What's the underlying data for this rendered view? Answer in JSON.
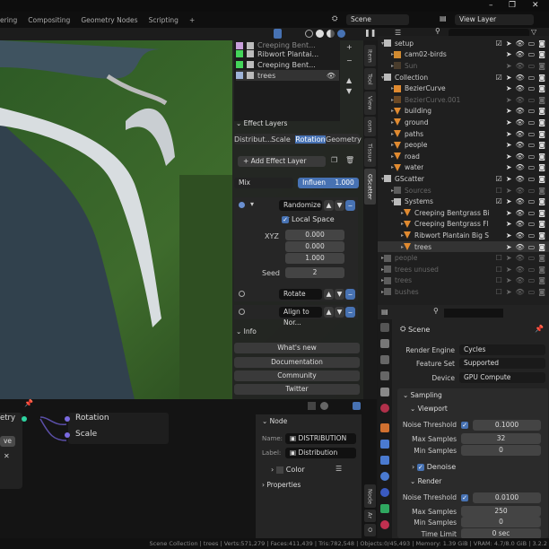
{
  "window": {
    "minimize": "–",
    "maximize": "❐",
    "close": "✕"
  },
  "workspace_tabs": [
    "ering",
    "Compositing",
    "Geometry Nodes",
    "Scripting",
    "+"
  ],
  "scene_field": "Scene",
  "view_layer_field": "View Layer",
  "npanel": {
    "layers": [
      {
        "name": "Creeping Bent...",
        "color": "#c9a0dc"
      },
      {
        "name": "Ribwort Plantai...",
        "color": "#44d45a"
      },
      {
        "name": "Creeping Bent...",
        "color": "#44d45a"
      },
      {
        "name": "trees",
        "color": "#9fb4d8"
      }
    ],
    "effect_layers_title": "Effect Layers",
    "effect_tabs": [
      "Distribut...",
      "Scale",
      "Rotation",
      "Geometry"
    ],
    "active_effect_tab": "Rotation",
    "add_effect_layer": "Add Effect Layer",
    "blend_mode": "Mix",
    "influence_label": "Influen",
    "influence_value": "1.000",
    "effects": [
      {
        "name": "Randomize ...",
        "expanded": true
      },
      {
        "name": "Rotate",
        "expanded": false
      },
      {
        "name": "Align to Nor...",
        "expanded": false
      }
    ],
    "local_space": "Local Space",
    "xyz_label": "XYZ",
    "xyz": [
      "0.000",
      "0.000",
      "1.000"
    ],
    "seed_label": "Seed",
    "seed": "2",
    "info_title": "Info",
    "info_buttons": [
      "What's new",
      "Documentation",
      "Community",
      "Twitter"
    ]
  },
  "side_tabs": [
    "Item",
    "Tool",
    "View",
    "osm",
    "Tissue",
    "GScatter"
  ],
  "side_tab_active": "GScatter",
  "outliner": [
    {
      "name": "setup",
      "indent": 0,
      "type": "collection",
      "check": true
    },
    {
      "name": "cam02-birds",
      "indent": 1,
      "type": "camera"
    },
    {
      "name": "Sun",
      "indent": 1,
      "type": "light",
      "dim": true
    },
    {
      "name": "Collection",
      "indent": 0,
      "type": "collection",
      "check": true
    },
    {
      "name": "BezierCurve",
      "indent": 1,
      "type": "curve"
    },
    {
      "name": "BezierCurve.001",
      "indent": 1,
      "type": "curve",
      "dim": true
    },
    {
      "name": "building",
      "indent": 1,
      "type": "mesh"
    },
    {
      "name": "ground",
      "indent": 1,
      "type": "mesh"
    },
    {
      "name": "paths",
      "indent": 1,
      "type": "mesh"
    },
    {
      "name": "people",
      "indent": 1,
      "type": "mesh"
    },
    {
      "name": "road",
      "indent": 1,
      "type": "mesh"
    },
    {
      "name": "water",
      "indent": 1,
      "type": "mesh"
    },
    {
      "name": "GScatter",
      "indent": 0,
      "type": "collection",
      "check": true
    },
    {
      "name": "Sources",
      "indent": 1,
      "type": "collection",
      "dim": true,
      "check": false
    },
    {
      "name": "Systems",
      "indent": 1,
      "type": "collection",
      "check": true
    },
    {
      "name": "Creeping Bentgrass Bi",
      "indent": 2,
      "type": "mesh"
    },
    {
      "name": "Creeping Bentgrass Fl",
      "indent": 2,
      "type": "mesh"
    },
    {
      "name": "Ribwort Plantain Big S",
      "indent": 2,
      "type": "mesh"
    },
    {
      "name": "trees",
      "indent": 2,
      "type": "mesh",
      "selected": true
    },
    {
      "name": "people",
      "indent": 0,
      "type": "collection",
      "dim": true,
      "check": false
    },
    {
      "name": "trees unused",
      "indent": 0,
      "type": "collection",
      "dim": true,
      "check": false
    },
    {
      "name": "trees",
      "indent": 0,
      "type": "collection",
      "dim": true,
      "check": false
    },
    {
      "name": "bushes",
      "indent": 0,
      "type": "collection",
      "dim": true,
      "check": false
    }
  ],
  "properties": {
    "context": "Scene",
    "render_engine_label": "Render Engine",
    "render_engine": "Cycles",
    "feature_set_label": "Feature Set",
    "feature_set": "Supported",
    "device_label": "Device",
    "device": "GPU Compute",
    "sampling": "Sampling",
    "viewport": "Viewport",
    "noise_threshold_label": "Noise Threshold",
    "vp_noise": "0.1000",
    "max_samples_label": "Max Samples",
    "vp_max": "32",
    "min_samples_label": "Min Samples",
    "vp_min": "0",
    "denoise": "Denoise",
    "render": "Render",
    "r_noise": "0.0100",
    "r_max": "250",
    "r_min": "0",
    "time_limit_label": "Time Limit",
    "time_limit": "0 sec"
  },
  "node_editor": {
    "socket_geometry": "etry",
    "socket_rotation": "Rotation",
    "socket_scale": "Scale",
    "button_partial": "ve",
    "panel_node": "Node",
    "name_label": "Name:",
    "name_value": "DISTRIBUTION",
    "label_label": "Label:",
    "label_value": "Distribution",
    "color_label": "Color",
    "properties_label": "Properties",
    "tabs": [
      "Node",
      "Ar",
      "O"
    ]
  },
  "status_bar": "Scene Collection | trees | Verts:571,279 | Faces:411,439 | Tris:782,548 | Objects:0/45,493 | Memory: 1.39 GiB | VRAM: 4.7/8.0 GiB | 3.2.2"
}
